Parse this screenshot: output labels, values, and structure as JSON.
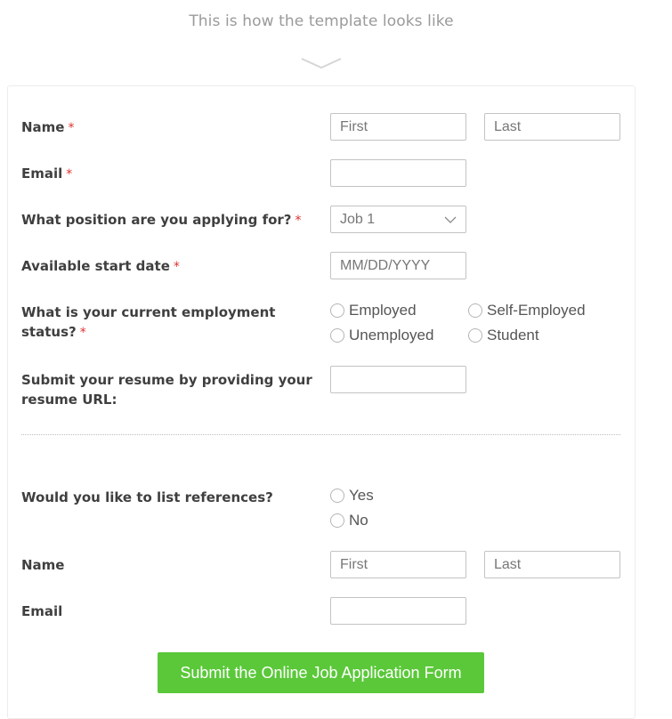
{
  "caption": "This is how the template looks like",
  "form": {
    "name": {
      "label": "Name",
      "required": "*",
      "first_placeholder": "First",
      "last_placeholder": "Last"
    },
    "email": {
      "label": "Email",
      "required": "*",
      "value": ""
    },
    "position": {
      "label": "What position are you applying for?",
      "required": "*",
      "selected": "Job 1"
    },
    "start_date": {
      "label": "Available start date",
      "required": "*",
      "placeholder": "MM/DD/YYYY"
    },
    "employment": {
      "label_line1": "What is your current employment",
      "label_line2": "status?",
      "required": "*",
      "options": [
        "Employed",
        "Self-Employed",
        "Unemployed",
        "Student"
      ]
    },
    "resume": {
      "label_line1": "Submit your resume by providing your",
      "label_line2": "resume URL:",
      "value": ""
    },
    "references": {
      "label": "Would you like to list references?",
      "options": [
        "Yes",
        "No"
      ]
    },
    "ref_name": {
      "label": "Name",
      "first_placeholder": "First",
      "last_placeholder": "Last"
    },
    "ref_email": {
      "label": "Email",
      "value": ""
    },
    "submit_label": "Submit the Online Job Application Form"
  },
  "colors": {
    "accent": "#5ac839",
    "required": "#e03131"
  },
  "icons": {
    "chevron": "chevron-down-icon",
    "select_arrow": "chevron-down-icon"
  }
}
